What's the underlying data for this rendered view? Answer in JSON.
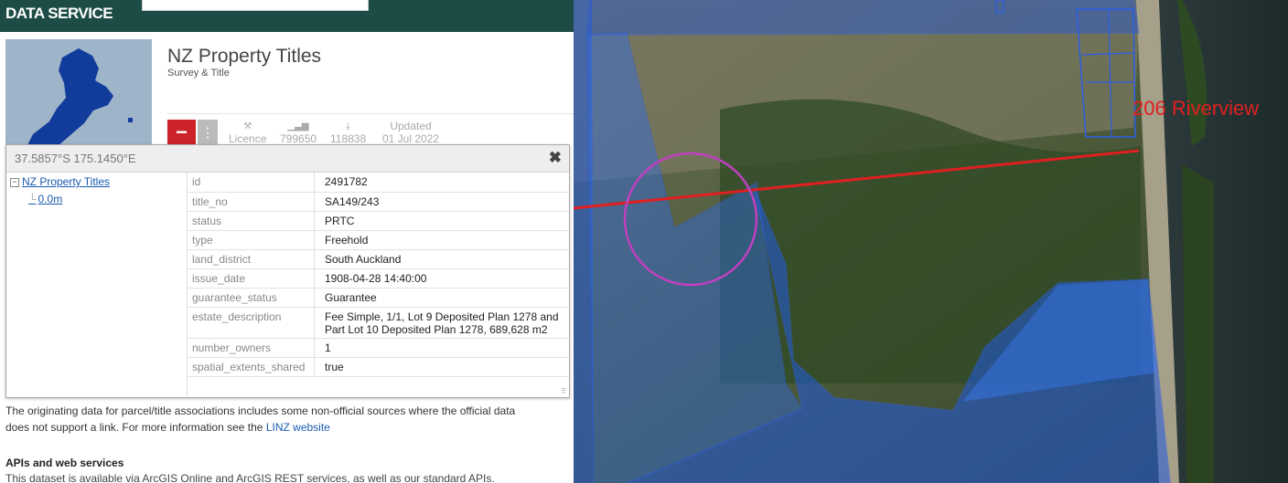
{
  "header": {
    "brand": "DATA SERVICE"
  },
  "dataset": {
    "title": "NZ Property Titles",
    "subtitle": "Survey & Title",
    "stats": [
      {
        "label": "Licence",
        "icon": "license-icon"
      },
      {
        "label": "799650",
        "icon": "bar-chart-icon"
      },
      {
        "label": "118838",
        "icon": "download-icon"
      },
      {
        "label": "01 Jul 2022",
        "heading": "Updated"
      }
    ],
    "remove_button": "−",
    "more_button": "⋮"
  },
  "popup": {
    "coords": "37.5857°S 175.1450°E",
    "close": "✖",
    "tree": {
      "root": "NZ Property Titles",
      "child": "0.0m"
    },
    "attributes": [
      {
        "key": "id",
        "value": "2491782"
      },
      {
        "key": "title_no",
        "value": "SA149/243"
      },
      {
        "key": "status",
        "value": "PRTC"
      },
      {
        "key": "type",
        "value": "Freehold"
      },
      {
        "key": "land_district",
        "value": "South Auckland"
      },
      {
        "key": "issue_date",
        "value": "1908-04-28 14:40:00"
      },
      {
        "key": "guarantee_status",
        "value": "Guarantee"
      },
      {
        "key": "estate_description",
        "value": "Fee Simple, 1/1, Lot 9 Deposited Plan 1278 and Part Lot 10 Deposited Plan 1278, 689,628 m2"
      },
      {
        "key": "number_owners",
        "value": "1"
      },
      {
        "key": "spatial_extents_shared",
        "value": "true"
      }
    ]
  },
  "body": {
    "paragraph_line1": "The originating data for parcel/title associations includes some non-official sources where the official data",
    "paragraph_line2": "does not support a link. For more information see the ",
    "link": "LINZ website",
    "apis_heading": "APIs and web services",
    "apis_text": "This dataset is available via ArcGIS Online and ArcGIS REST services, as well as our standard APIs."
  },
  "map": {
    "annotation": "206 Riverview"
  },
  "colors": {
    "brand_bar": "#1d4b45",
    "remove_button": "#cc2229",
    "annotation_red": "#e02020",
    "circle_magenta": "#c040c0",
    "parcel_blue": "#1f5ae0"
  }
}
